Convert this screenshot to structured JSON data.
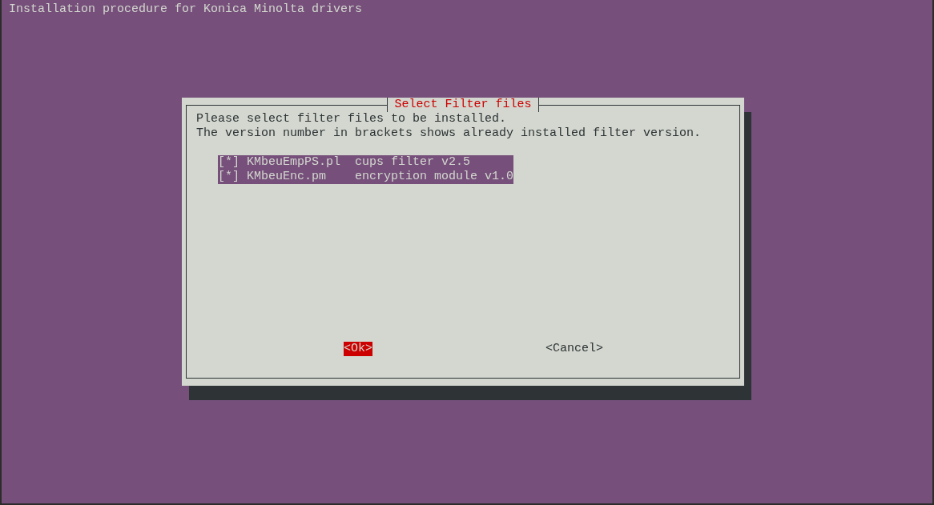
{
  "terminal": {
    "title": "Installation procedure for Konica Minolta drivers"
  },
  "dialog": {
    "title": "Select Filter files",
    "message": [
      "Please select filter files to be installed.",
      "The version number in brackets shows already installed filter version."
    ],
    "items": [
      {
        "mark": "[*]",
        "name": "KMbeuEmpPS.pl",
        "description": "cups filter v2.5",
        "selected": true
      },
      {
        "mark": "[*]",
        "name": "KMbeuEnc.pm",
        "description": "encryption module v1.0",
        "selected": true
      }
    ],
    "buttons": [
      {
        "label": "<Ok>",
        "selected": true
      },
      {
        "label": "<Cancel>",
        "selected": false
      }
    ]
  }
}
